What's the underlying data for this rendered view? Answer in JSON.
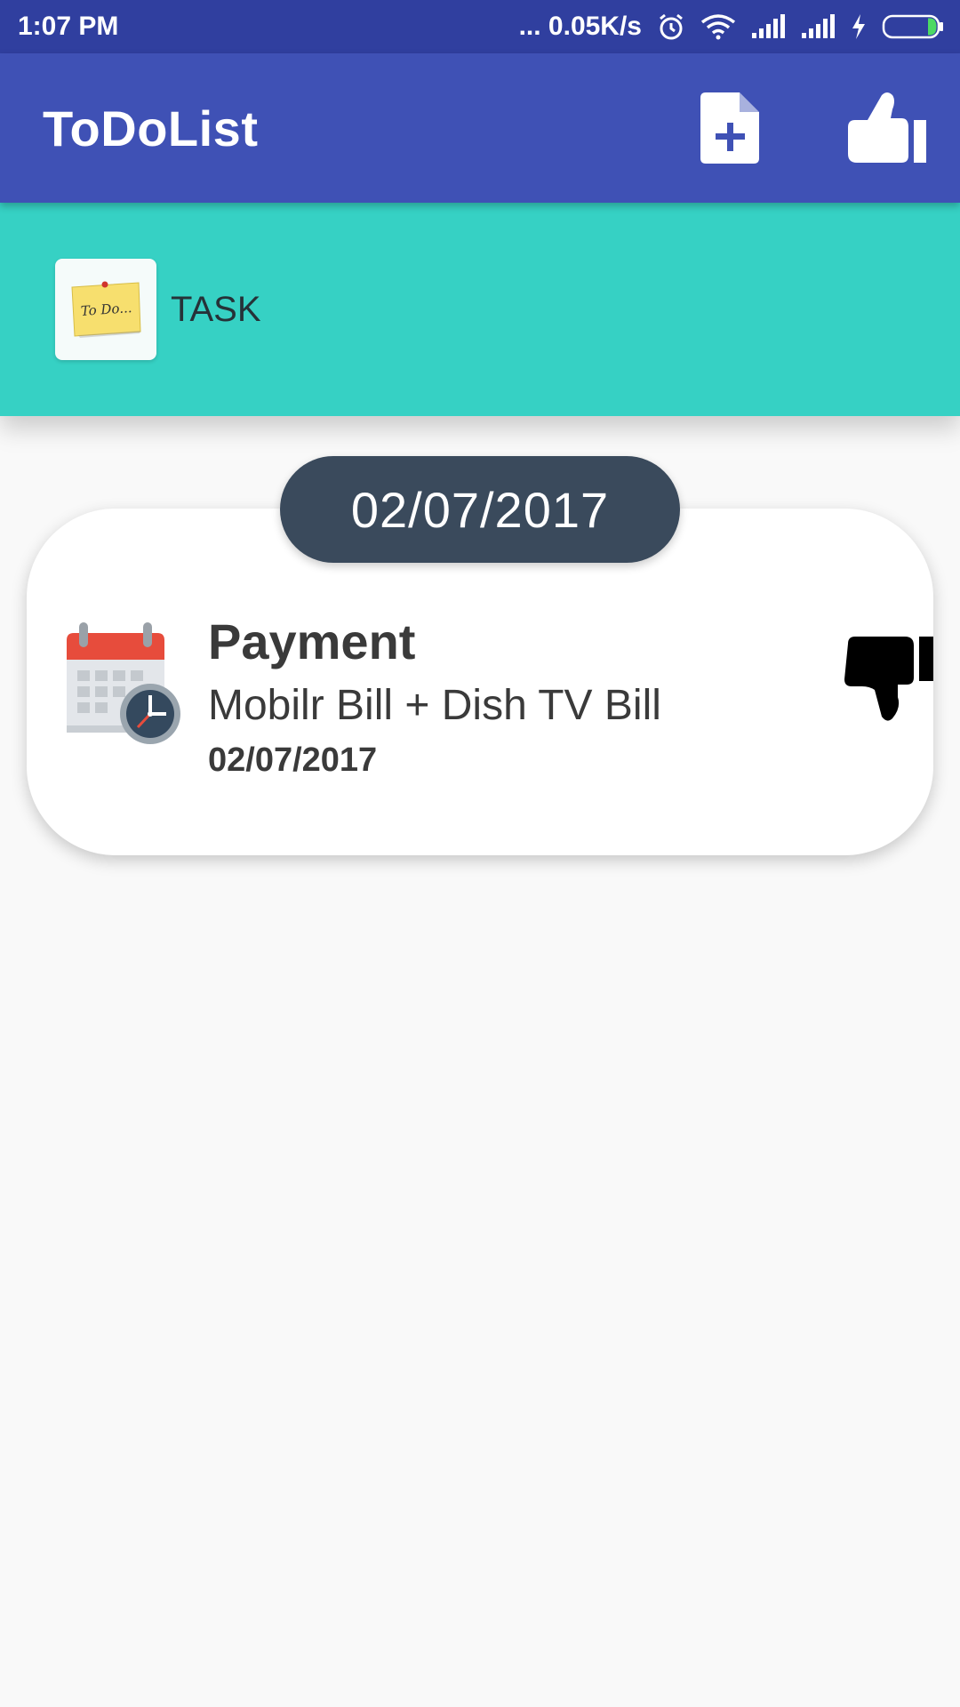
{
  "status_bar": {
    "time": "1:07 PM",
    "speed": "... 0.05K/s",
    "icons": [
      "alarm-icon",
      "wifi-icon",
      "signal-icon",
      "signal-icon",
      "charging-icon",
      "battery-icon"
    ]
  },
  "app_bar": {
    "title": "ToDoList",
    "actions": [
      "add-file-icon",
      "thumbs-up-icon"
    ]
  },
  "tabs": [
    {
      "label": "TASK",
      "icon": "todo-note-icon",
      "icon_text": "To Do..."
    }
  ],
  "date_header": "02/07/2017",
  "tasks": [
    {
      "title": "Payment",
      "description": "Mobilr Bill + Dish TV Bill",
      "date": "02/07/2017",
      "icon": "calendar-clock-icon",
      "action_icon": "thumbs-down-icon"
    }
  ],
  "colors": {
    "status_bar": "#303f9f",
    "app_bar": "#3f51b5",
    "tab_strip": "#36d1c4",
    "date_pill": "#3a4a5c",
    "background": "#f9f9f9"
  }
}
